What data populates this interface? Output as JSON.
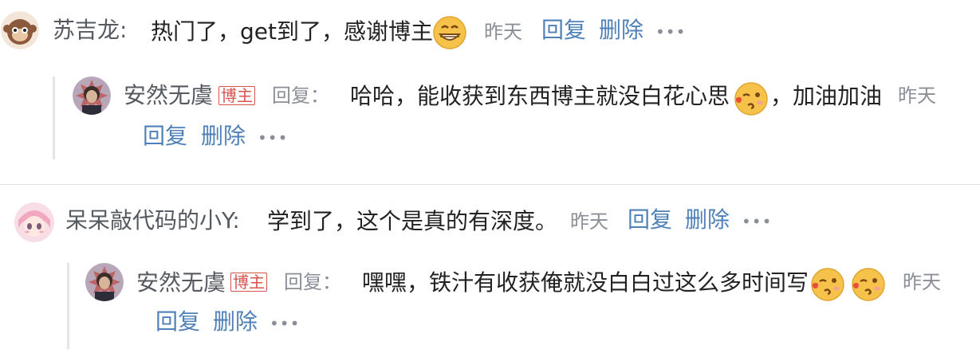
{
  "comments": [
    {
      "author": "苏吉龙:",
      "text": "热门了，get到了，感谢博主",
      "emoji": "grinning-face",
      "time": "昨天",
      "reply_label": "回复",
      "delete_label": "删除",
      "reply": {
        "author": "安然无虞",
        "badge": "博主",
        "reply_tag": "回复：",
        "text": "哈哈，能收获到东西博主就没白花心思",
        "emoji": "blowing-kiss-face",
        "text_after": "，加油加油",
        "time": "昨天",
        "reply_label": "回复",
        "delete_label": "删除"
      }
    },
    {
      "author": "呆呆敲代码的小Y:",
      "text": "学到了，这个是真的有深度。",
      "time": "昨天",
      "reply_label": "回复",
      "delete_label": "删除",
      "reply": {
        "author": "安然无虞",
        "badge": "博主",
        "reply_tag": "回复：",
        "text": "嘿嘿，铁汁有收获俺就没白白过这么多时间写",
        "emojis": [
          "blowing-kiss-face",
          "blowing-kiss-face"
        ],
        "time": "昨天",
        "reply_label": "回复",
        "delete_label": "删除"
      }
    }
  ],
  "colors": {
    "link": "#4f81b8",
    "muted": "#8a8f97",
    "badge": "#d9534f"
  }
}
